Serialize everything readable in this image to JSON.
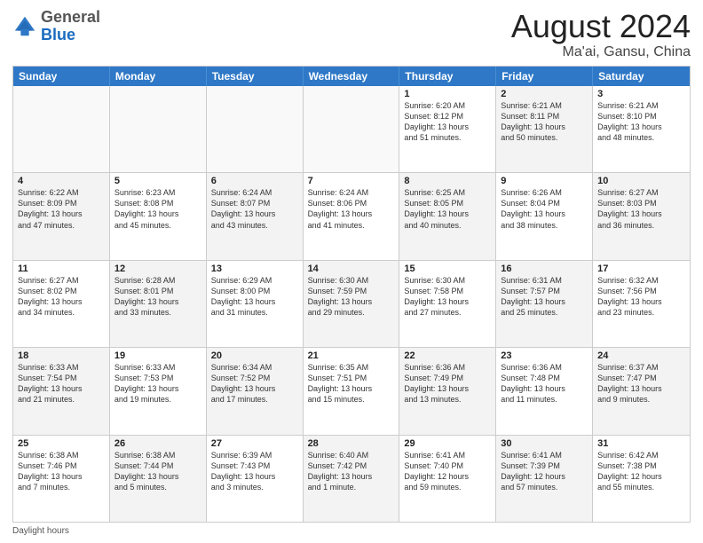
{
  "header": {
    "logo_general": "General",
    "logo_blue": "Blue",
    "month_year": "August 2024",
    "location": "Ma'ai, Gansu, China"
  },
  "footer": {
    "daylight_label": "Daylight hours"
  },
  "days_of_week": [
    "Sunday",
    "Monday",
    "Tuesday",
    "Wednesday",
    "Thursday",
    "Friday",
    "Saturday"
  ],
  "weeks": [
    [
      {
        "day": "",
        "text": "",
        "shaded": false,
        "empty": true
      },
      {
        "day": "",
        "text": "",
        "shaded": false,
        "empty": true
      },
      {
        "day": "",
        "text": "",
        "shaded": false,
        "empty": true
      },
      {
        "day": "",
        "text": "",
        "shaded": false,
        "empty": true
      },
      {
        "day": "1",
        "text": "Sunrise: 6:20 AM\nSunset: 8:12 PM\nDaylight: 13 hours\nand 51 minutes.",
        "shaded": false,
        "empty": false
      },
      {
        "day": "2",
        "text": "Sunrise: 6:21 AM\nSunset: 8:11 PM\nDaylight: 13 hours\nand 50 minutes.",
        "shaded": true,
        "empty": false
      },
      {
        "day": "3",
        "text": "Sunrise: 6:21 AM\nSunset: 8:10 PM\nDaylight: 13 hours\nand 48 minutes.",
        "shaded": false,
        "empty": false
      }
    ],
    [
      {
        "day": "4",
        "text": "Sunrise: 6:22 AM\nSunset: 8:09 PM\nDaylight: 13 hours\nand 47 minutes.",
        "shaded": true,
        "empty": false
      },
      {
        "day": "5",
        "text": "Sunrise: 6:23 AM\nSunset: 8:08 PM\nDaylight: 13 hours\nand 45 minutes.",
        "shaded": false,
        "empty": false
      },
      {
        "day": "6",
        "text": "Sunrise: 6:24 AM\nSunset: 8:07 PM\nDaylight: 13 hours\nand 43 minutes.",
        "shaded": true,
        "empty": false
      },
      {
        "day": "7",
        "text": "Sunrise: 6:24 AM\nSunset: 8:06 PM\nDaylight: 13 hours\nand 41 minutes.",
        "shaded": false,
        "empty": false
      },
      {
        "day": "8",
        "text": "Sunrise: 6:25 AM\nSunset: 8:05 PM\nDaylight: 13 hours\nand 40 minutes.",
        "shaded": true,
        "empty": false
      },
      {
        "day": "9",
        "text": "Sunrise: 6:26 AM\nSunset: 8:04 PM\nDaylight: 13 hours\nand 38 minutes.",
        "shaded": false,
        "empty": false
      },
      {
        "day": "10",
        "text": "Sunrise: 6:27 AM\nSunset: 8:03 PM\nDaylight: 13 hours\nand 36 minutes.",
        "shaded": true,
        "empty": false
      }
    ],
    [
      {
        "day": "11",
        "text": "Sunrise: 6:27 AM\nSunset: 8:02 PM\nDaylight: 13 hours\nand 34 minutes.",
        "shaded": false,
        "empty": false
      },
      {
        "day": "12",
        "text": "Sunrise: 6:28 AM\nSunset: 8:01 PM\nDaylight: 13 hours\nand 33 minutes.",
        "shaded": true,
        "empty": false
      },
      {
        "day": "13",
        "text": "Sunrise: 6:29 AM\nSunset: 8:00 PM\nDaylight: 13 hours\nand 31 minutes.",
        "shaded": false,
        "empty": false
      },
      {
        "day": "14",
        "text": "Sunrise: 6:30 AM\nSunset: 7:59 PM\nDaylight: 13 hours\nand 29 minutes.",
        "shaded": true,
        "empty": false
      },
      {
        "day": "15",
        "text": "Sunrise: 6:30 AM\nSunset: 7:58 PM\nDaylight: 13 hours\nand 27 minutes.",
        "shaded": false,
        "empty": false
      },
      {
        "day": "16",
        "text": "Sunrise: 6:31 AM\nSunset: 7:57 PM\nDaylight: 13 hours\nand 25 minutes.",
        "shaded": true,
        "empty": false
      },
      {
        "day": "17",
        "text": "Sunrise: 6:32 AM\nSunset: 7:56 PM\nDaylight: 13 hours\nand 23 minutes.",
        "shaded": false,
        "empty": false
      }
    ],
    [
      {
        "day": "18",
        "text": "Sunrise: 6:33 AM\nSunset: 7:54 PM\nDaylight: 13 hours\nand 21 minutes.",
        "shaded": true,
        "empty": false
      },
      {
        "day": "19",
        "text": "Sunrise: 6:33 AM\nSunset: 7:53 PM\nDaylight: 13 hours\nand 19 minutes.",
        "shaded": false,
        "empty": false
      },
      {
        "day": "20",
        "text": "Sunrise: 6:34 AM\nSunset: 7:52 PM\nDaylight: 13 hours\nand 17 minutes.",
        "shaded": true,
        "empty": false
      },
      {
        "day": "21",
        "text": "Sunrise: 6:35 AM\nSunset: 7:51 PM\nDaylight: 13 hours\nand 15 minutes.",
        "shaded": false,
        "empty": false
      },
      {
        "day": "22",
        "text": "Sunrise: 6:36 AM\nSunset: 7:49 PM\nDaylight: 13 hours\nand 13 minutes.",
        "shaded": true,
        "empty": false
      },
      {
        "day": "23",
        "text": "Sunrise: 6:36 AM\nSunset: 7:48 PM\nDaylight: 13 hours\nand 11 minutes.",
        "shaded": false,
        "empty": false
      },
      {
        "day": "24",
        "text": "Sunrise: 6:37 AM\nSunset: 7:47 PM\nDaylight: 13 hours\nand 9 minutes.",
        "shaded": true,
        "empty": false
      }
    ],
    [
      {
        "day": "25",
        "text": "Sunrise: 6:38 AM\nSunset: 7:46 PM\nDaylight: 13 hours\nand 7 minutes.",
        "shaded": false,
        "empty": false
      },
      {
        "day": "26",
        "text": "Sunrise: 6:38 AM\nSunset: 7:44 PM\nDaylight: 13 hours\nand 5 minutes.",
        "shaded": true,
        "empty": false
      },
      {
        "day": "27",
        "text": "Sunrise: 6:39 AM\nSunset: 7:43 PM\nDaylight: 13 hours\nand 3 minutes.",
        "shaded": false,
        "empty": false
      },
      {
        "day": "28",
        "text": "Sunrise: 6:40 AM\nSunset: 7:42 PM\nDaylight: 13 hours\nand 1 minute.",
        "shaded": true,
        "empty": false
      },
      {
        "day": "29",
        "text": "Sunrise: 6:41 AM\nSunset: 7:40 PM\nDaylight: 12 hours\nand 59 minutes.",
        "shaded": false,
        "empty": false
      },
      {
        "day": "30",
        "text": "Sunrise: 6:41 AM\nSunset: 7:39 PM\nDaylight: 12 hours\nand 57 minutes.",
        "shaded": true,
        "empty": false
      },
      {
        "day": "31",
        "text": "Sunrise: 6:42 AM\nSunset: 7:38 PM\nDaylight: 12 hours\nand 55 minutes.",
        "shaded": false,
        "empty": false
      }
    ]
  ]
}
